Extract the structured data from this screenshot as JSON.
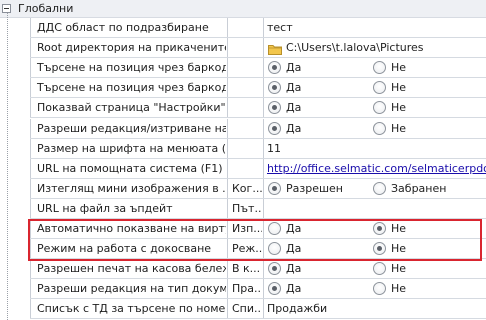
{
  "group": {
    "title": "Глобални"
  },
  "rows": [
    {
      "name": "ДДС област по подразбиране",
      "value": "",
      "kind": "text",
      "text": "тест"
    },
    {
      "name": "Root директория на прикачените...",
      "value": "",
      "kind": "folder",
      "text": "C:\\Users\\t.lalova\\Pictures"
    },
    {
      "name": "Търсене на позиция чрез баркод ...",
      "value": "",
      "kind": "radio",
      "opt1": "Да",
      "opt2": "Не",
      "selected": 1
    },
    {
      "name": "Търсене на позиция чрез баркод ...",
      "value": "",
      "kind": "radio",
      "opt1": "Да",
      "opt2": "Не",
      "selected": 1
    },
    {
      "name": "Показвай страница \"Настройки\"",
      "value": "",
      "kind": "radio",
      "opt1": "Да",
      "opt2": "Не",
      "selected": 1
    },
    {
      "name": "Разреши редакция/изтриване на ...",
      "value": "",
      "kind": "radio",
      "opt1": "Да",
      "opt2": "Не",
      "selected": 1
    },
    {
      "name": "Размер на шрифта на менюата (...",
      "value": "",
      "kind": "text",
      "text": "11"
    },
    {
      "name": "URL на помощната система (F1)",
      "value": "",
      "kind": "link",
      "text": "http://office.selmatic.com/selmaticerpdoc/..."
    },
    {
      "name": "Изтеглящ мини изображения в ...",
      "value": "Ког...",
      "kind": "radio",
      "opt1": "Разрешен",
      "opt2": "Забранен",
      "selected": 1
    },
    {
      "name": "URL на файл за ъпдейт",
      "value": "Път...",
      "kind": "text",
      "text": ""
    },
    {
      "name": "Автоматично показване на вирту...",
      "value": "Изп...",
      "kind": "radio",
      "opt1": "Да",
      "opt2": "Не",
      "selected": 2
    },
    {
      "name": "Режим на работа с докосване",
      "value": "Реж...",
      "kind": "radio",
      "opt1": "Да",
      "opt2": "Не",
      "selected": 2
    },
    {
      "name": "Разрешен печат на касова бележка",
      "value": "В к...",
      "kind": "radio",
      "opt1": "Да",
      "opt2": "Не",
      "selected": 1
    },
    {
      "name": "Разреши редакция на тип документ",
      "value": "Пра...",
      "kind": "radio",
      "opt1": "Да",
      "opt2": "Не",
      "selected": 1
    },
    {
      "name": "Списък с ТД за търсене по номер",
      "value": "Спи...",
      "kind": "text",
      "text": "Продажби"
    }
  ],
  "colors": {
    "highlight": "#d9252f",
    "link": "#1a0dab"
  }
}
